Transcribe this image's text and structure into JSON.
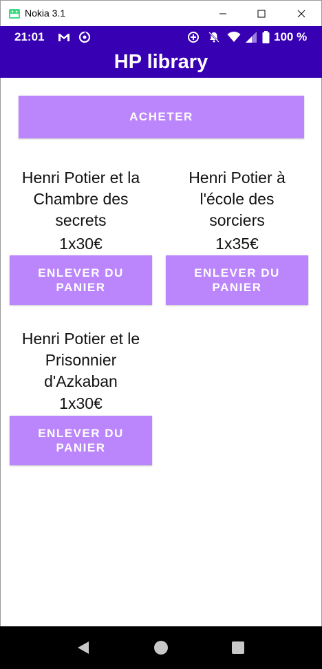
{
  "window": {
    "title": "Nokia 3.1",
    "app_icon": "android-emulator-icon",
    "controls": [
      "minimize-icon",
      "maximize-icon",
      "close-icon"
    ]
  },
  "status_bar": {
    "time": "21:01",
    "left_icons": [
      "gmail-icon",
      "sync-icon"
    ],
    "right_icons": [
      "data-saver-icon",
      "notifications-off-icon",
      "wifi-icon",
      "signal-icon",
      "battery-icon"
    ],
    "battery": "100 %"
  },
  "app_bar": {
    "title": "HP library"
  },
  "buy_button": {
    "label": "ACHETER"
  },
  "books": [
    {
      "title": "Henri Potier et la Chambre des secrets",
      "quantity": "1x30€",
      "remove_label": "ENLEVER DU PANIER"
    },
    {
      "title": "Henri Potier à l'école des sorciers",
      "quantity": "1x35€",
      "remove_label": "ENLEVER DU PANIER"
    },
    {
      "title": "Henri Potier et le Prisonnier d'Azkaban",
      "quantity": "1x30€",
      "remove_label": "ENLEVER DU PANIER"
    }
  ],
  "nav_bar": {
    "buttons": [
      "back-icon",
      "home-icon",
      "recents-icon"
    ]
  },
  "colors": {
    "primary_dark": "#3700b3",
    "accent": "#bb86fc",
    "nav_bar": "#000000",
    "text": "#111111"
  }
}
